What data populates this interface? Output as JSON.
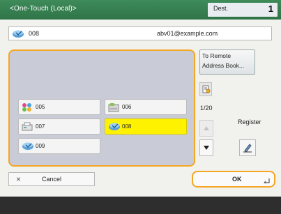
{
  "header": {
    "title": "<One-Touch (Local)>",
    "dest_label": "Dest.",
    "dest_count": "1"
  },
  "selected_destination": {
    "number": "008",
    "address": "abv01@example.com",
    "icon": "email-icon"
  },
  "destinations": [
    {
      "number": "005",
      "icon": "group-icon",
      "selected": false
    },
    {
      "number": "006",
      "icon": "file-server-icon",
      "selected": false
    },
    {
      "number": "007",
      "icon": "fax-icon",
      "selected": false
    },
    {
      "number": "008",
      "icon": "email-icon",
      "selected": true
    },
    {
      "number": "009",
      "icon": "email-icon",
      "selected": false
    }
  ],
  "side": {
    "remote_line1": "To Remote",
    "remote_line2": "Address Book...",
    "page_indicator": "1/20",
    "register_label": "Register"
  },
  "bottom": {
    "cancel_label": "Cancel",
    "ok_label": "OK"
  },
  "colors": {
    "header_green": "#2f7447",
    "selected_yellow": "#fff200",
    "focus_orange": "#f5a623",
    "panel_gray": "#c9ccd6"
  }
}
